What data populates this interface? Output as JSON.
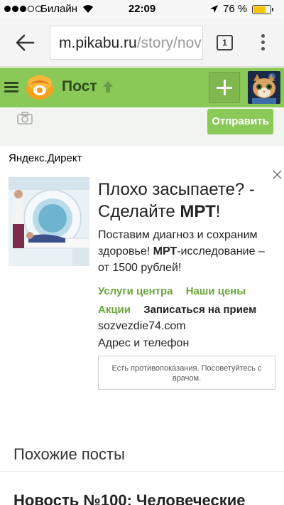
{
  "status_bar": {
    "carrier": "Билайн",
    "time": "22:09",
    "battery": "76 %",
    "battery_level": 0.76,
    "signal_bars": 3
  },
  "browser": {
    "url_domain": "m.pikabu.ru",
    "url_path": "/story/nov",
    "tab_count": "1"
  },
  "header": {
    "title": "Пост",
    "color": "#8ac858"
  },
  "comment": {
    "send_label": "Отправить"
  },
  "ad": {
    "source": "Яндекс.Директ",
    "title_part1": "Плохо засыпаете? - Сделайте ",
    "title_bold": "МРТ",
    "title_part2": "!",
    "body_part1": "Поставим диагноз и сохраним здоровье! ",
    "body_bold": "МРТ",
    "body_part2": "-исследование – от 1500 рублей!",
    "links": [
      {
        "label": "Услуги центра",
        "style": "green"
      },
      {
        "label": "Наши цены",
        "style": "green"
      },
      {
        "label": "Акции",
        "style": "green"
      },
      {
        "label": "Записаться на прием",
        "style": "dark"
      }
    ],
    "domain": "sozvezdie74.com",
    "contacts": "Адрес и телефон",
    "warning": "Есть противопоказания. Посоветуйтесь с врачом."
  },
  "similar": {
    "heading": "Похожие посты",
    "first_post": "Новость №100: Человеческие"
  }
}
